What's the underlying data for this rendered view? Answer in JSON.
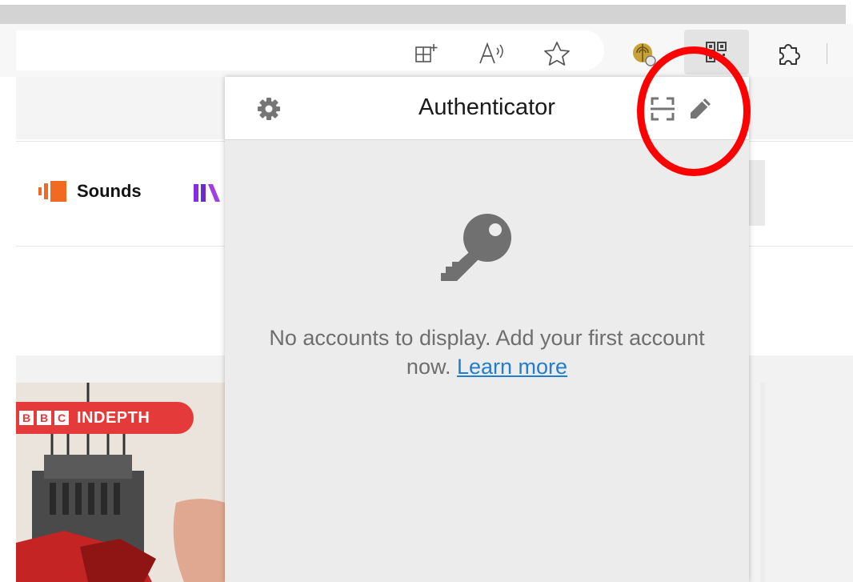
{
  "popup": {
    "title": "Authenticator",
    "empty_message": "No accounts to display. Add your first account now.",
    "learn_more": "Learn more"
  },
  "page": {
    "nav_sounds": "Sounds",
    "badge_letters": [
      "B",
      "B",
      "C"
    ],
    "badge_label": "INDEPTH"
  },
  "icons": {
    "toolbar": [
      "split-screen-icon",
      "read-aloud-icon",
      "favorite-star-icon",
      "extension-profile-icon",
      "authenticator-extension-icon",
      "extensions-puzzle-icon"
    ],
    "popup": [
      "settings-gear-icon",
      "scan-qr-icon",
      "edit-pencil-icon",
      "key-icon"
    ]
  },
  "colors": {
    "annotation": "#ff0000",
    "link": "#1f7ed0",
    "badge": "#e53a3a",
    "sounds_orange": "#f26a21"
  }
}
